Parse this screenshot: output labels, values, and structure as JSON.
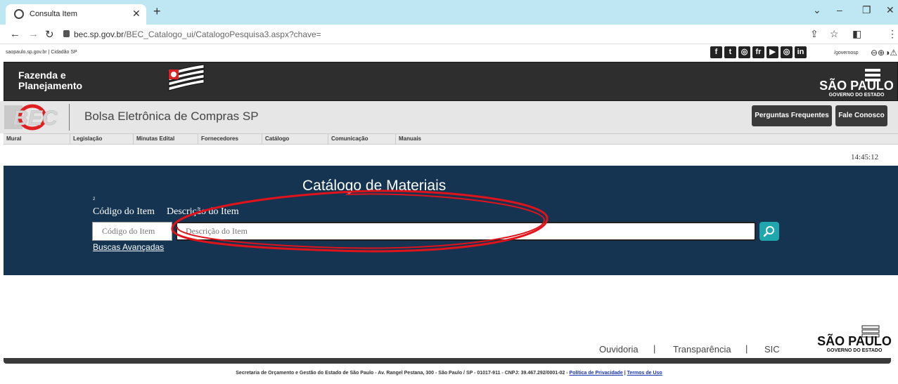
{
  "browser": {
    "tab_title": "Consulta Item",
    "url_host": "bec.sp.gov.br",
    "url_path": "/BEC_Catalogo_ui/CatalogoPesquisa3.aspx?chave="
  },
  "gov_strip": {
    "links": "saopaulo.sp.gov.br  |  Cidadão SP",
    "social": [
      "f",
      "t",
      "◎",
      "fr",
      "▶",
      "◎",
      "in"
    ],
    "handle": "/governosp",
    "a11y": "⊖⊕◑⚠"
  },
  "header": {
    "fazenda_line1": "Fazenda e",
    "fazenda_line2": "Planejamento",
    "sp_logo_main": "SÃO PAULO",
    "sp_logo_sub": "GOVERNO DO ESTADO"
  },
  "bec": {
    "logo_text": "BEC",
    "title": "Bolsa Eletrônica de Compras SP",
    "faq_button": "Perguntas Frequentes",
    "contact_button": "Fale Conosco"
  },
  "menu": {
    "items": [
      "Mural",
      "Legislação",
      "Minutas Edital",
      "Fornecedores",
      "Catálogo",
      "Comunicação",
      "Manuais"
    ]
  },
  "clock": "14:45:12",
  "search": {
    "title": "Catálogo de Materiais",
    "tiny_number": "2",
    "codigo_label": "Código do Item",
    "descricao_label": "Descrição do Item",
    "codigo_placeholder": "Código do Item",
    "descricao_placeholder": "Descrição do Item",
    "advanced_link": "Buscas Avançadas"
  },
  "footer": {
    "ouvidoria": "Ouvidoria",
    "transparencia": "Transparência",
    "sic": "SIC",
    "separator": "|",
    "address": "Secretaria de Orçamento e Gestão do Estado de São Paulo - Av. Rangel Pestana, 300 - São Paulo / SP - 01017-911 - CNPJ: 39.467.292/0001-02 - ",
    "privacy": "Política de Privacidade",
    "terms": "Termos de Uso"
  },
  "colors": {
    "panel_bg": "#143451",
    "search_button": "#20a6ad",
    "annotation": "#e0131b"
  }
}
